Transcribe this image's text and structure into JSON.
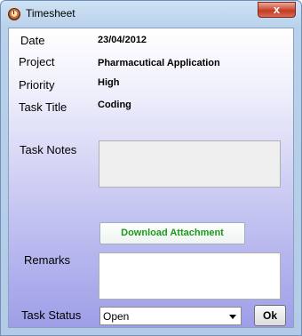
{
  "window": {
    "title": "Timesheet",
    "close_label": "x"
  },
  "fields": {
    "date_label": "Date",
    "date_value": "23/04/2012",
    "project_label": "Project",
    "project_value": "Pharmacutical Application",
    "priority_label": "Priority",
    "priority_value": "High",
    "task_title_label": "Task Title",
    "task_title_value": "Coding",
    "task_notes_label": "Task Notes",
    "task_notes_value": "",
    "remarks_label": "Remarks",
    "remarks_value": "",
    "task_status_label": "Task Status",
    "task_status_value": "Open"
  },
  "buttons": {
    "download_label": "Download Attachment",
    "ok_label": "Ok"
  },
  "colors": {
    "download_text": "#1a9a1a",
    "close_button": "#c43a24"
  }
}
